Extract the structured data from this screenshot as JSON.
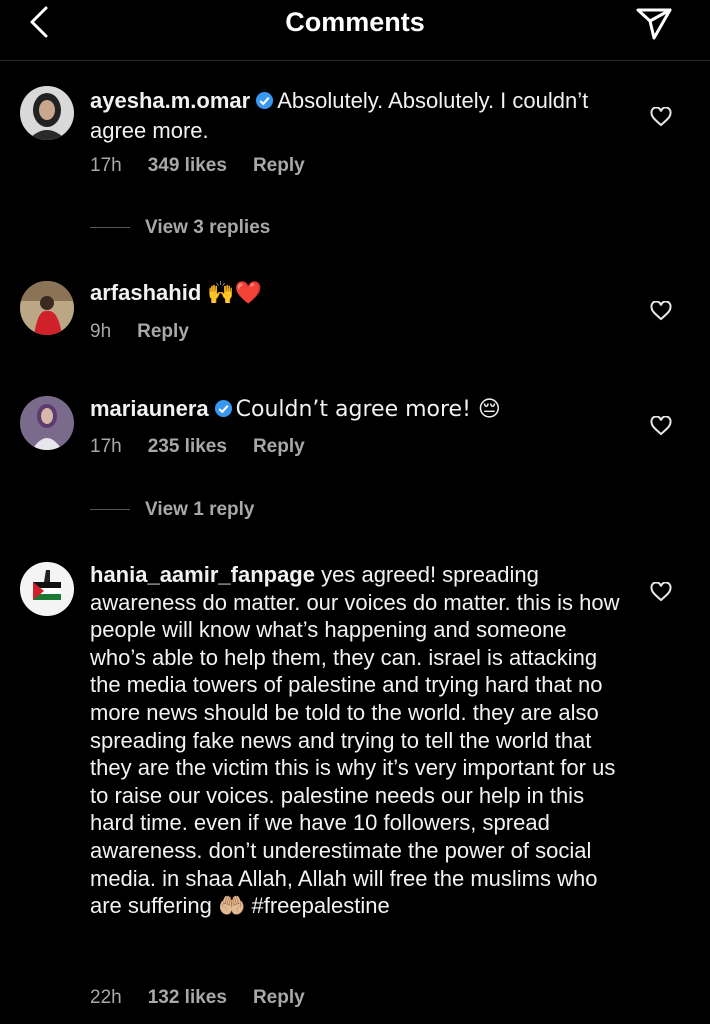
{
  "header": {
    "title": "Comments",
    "back_icon": "chevron-left-icon",
    "send_icon": "paper-plane-icon"
  },
  "comments": [
    {
      "username": "ayesha.m.omar",
      "verified": true,
      "text": "Absolutely. Absolutely. I couldn’t agree more.",
      "time": "17h",
      "likes": "349 likes",
      "reply": "Reply",
      "view_replies": "View 3 replies"
    },
    {
      "username": "arfashahid",
      "verified": false,
      "text": "🙌❤️",
      "time": "9h",
      "reply": "Reply"
    },
    {
      "username": "mariaunera",
      "verified": true,
      "text": "Couldn’t agree more! 😔",
      "time": "17h",
      "likes": "235 likes",
      "reply": "Reply",
      "view_replies": "View 1 reply"
    },
    {
      "username": "hania_aamir_fanpage",
      "verified": false,
      "text": "yes agreed! spreading awareness do matter. our voices do matter. this is how people will know what’s happening and someone who’s able to help them, they can. israel is attacking the media towers of palestine and trying hard that no more news should be told to the world. they are also spreading fake news and trying to tell the world that they are the victim this is why it’s very important for us to raise our voices. palestine needs our help in this hard time. even if we have 10 followers, spread awareness. don’t underestimate the power of social media. in shaa Allah, Allah will free the muslims who are suffering 🤲🏼 #freepalestine",
      "time": "22h",
      "likes": "132 likes",
      "reply": "Reply"
    }
  ],
  "colors": {
    "background": "#000000",
    "text": "#f5f5f5",
    "meta": "#a8a8a8",
    "verified": "#3897f0"
  }
}
